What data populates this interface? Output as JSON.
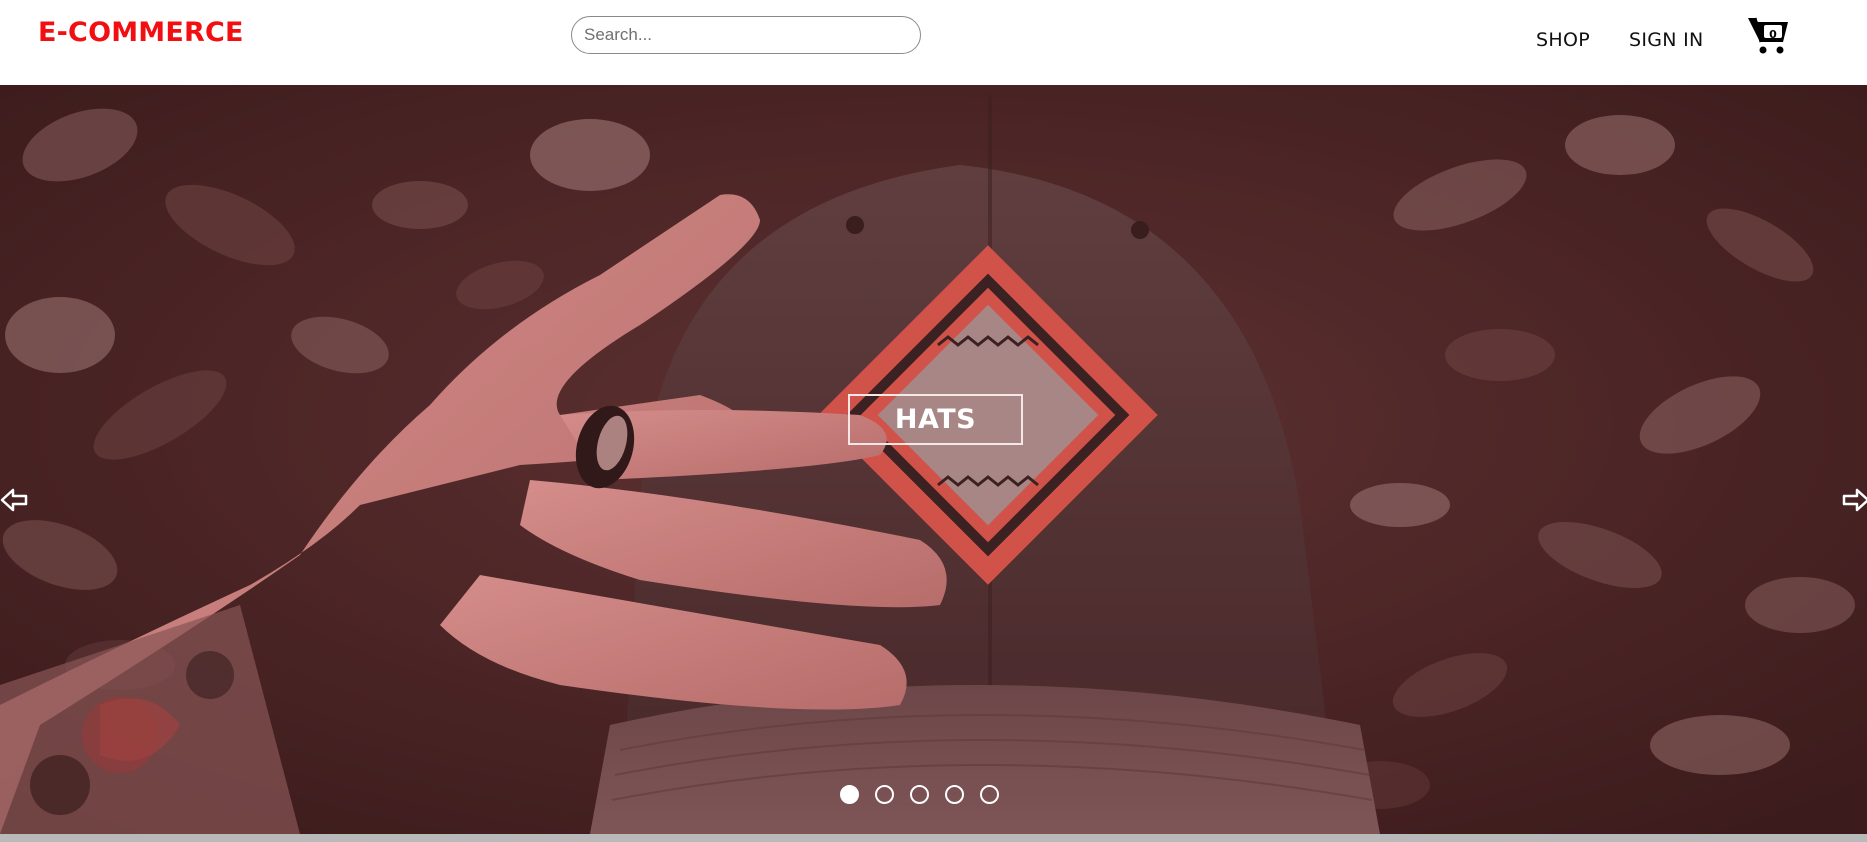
{
  "header": {
    "logo": "E-COMMERCE",
    "search_placeholder": "Search...",
    "nav": [
      "SHOP",
      "SIGN IN"
    ],
    "cart_count": "0"
  },
  "hero": {
    "title": "HATS",
    "slides_total": 5,
    "active_slide": 1,
    "overlay_color": "#7a2a2a"
  },
  "icons": {
    "cart": "shopping-cart-icon",
    "prev": "arrow-left-icon",
    "next": "arrow-right-icon"
  },
  "colors": {
    "brand": "#f10f12",
    "header_bg": "#ffffff",
    "footer_strip": "#b9b9b9"
  }
}
